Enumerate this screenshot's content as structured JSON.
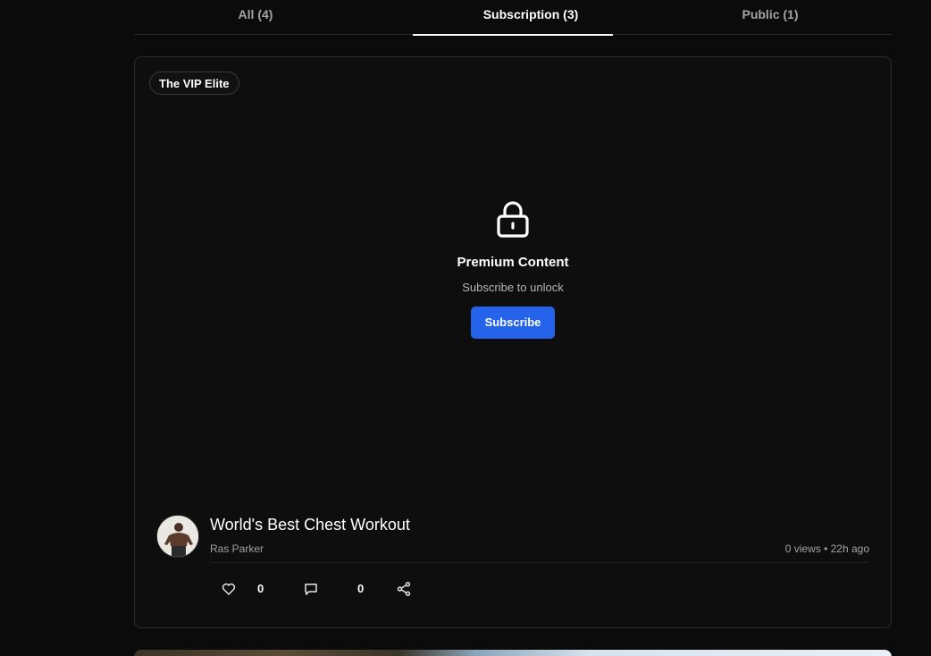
{
  "tabs": [
    {
      "label": "All (4)"
    },
    {
      "label": "Subscription (3)"
    },
    {
      "label": "Public (1)"
    }
  ],
  "active_tab": "Subscription (3)",
  "post": {
    "tier_badge": "The VIP Elite",
    "locked_title": "Premium Content",
    "locked_subtitle": "Subscribe to unlock",
    "subscribe_label": "Subscribe",
    "title": "World's Best Chest Workout",
    "author": "Ras Parker",
    "stats": "0 views • 22h ago",
    "likes": "0",
    "comments": "0"
  },
  "colors": {
    "background": "#0b0b0b",
    "card": "#0e0e0e",
    "accent": "#2563eb"
  },
  "icons": [
    "lock-icon",
    "heart-icon",
    "comment-icon",
    "share-icon"
  ]
}
